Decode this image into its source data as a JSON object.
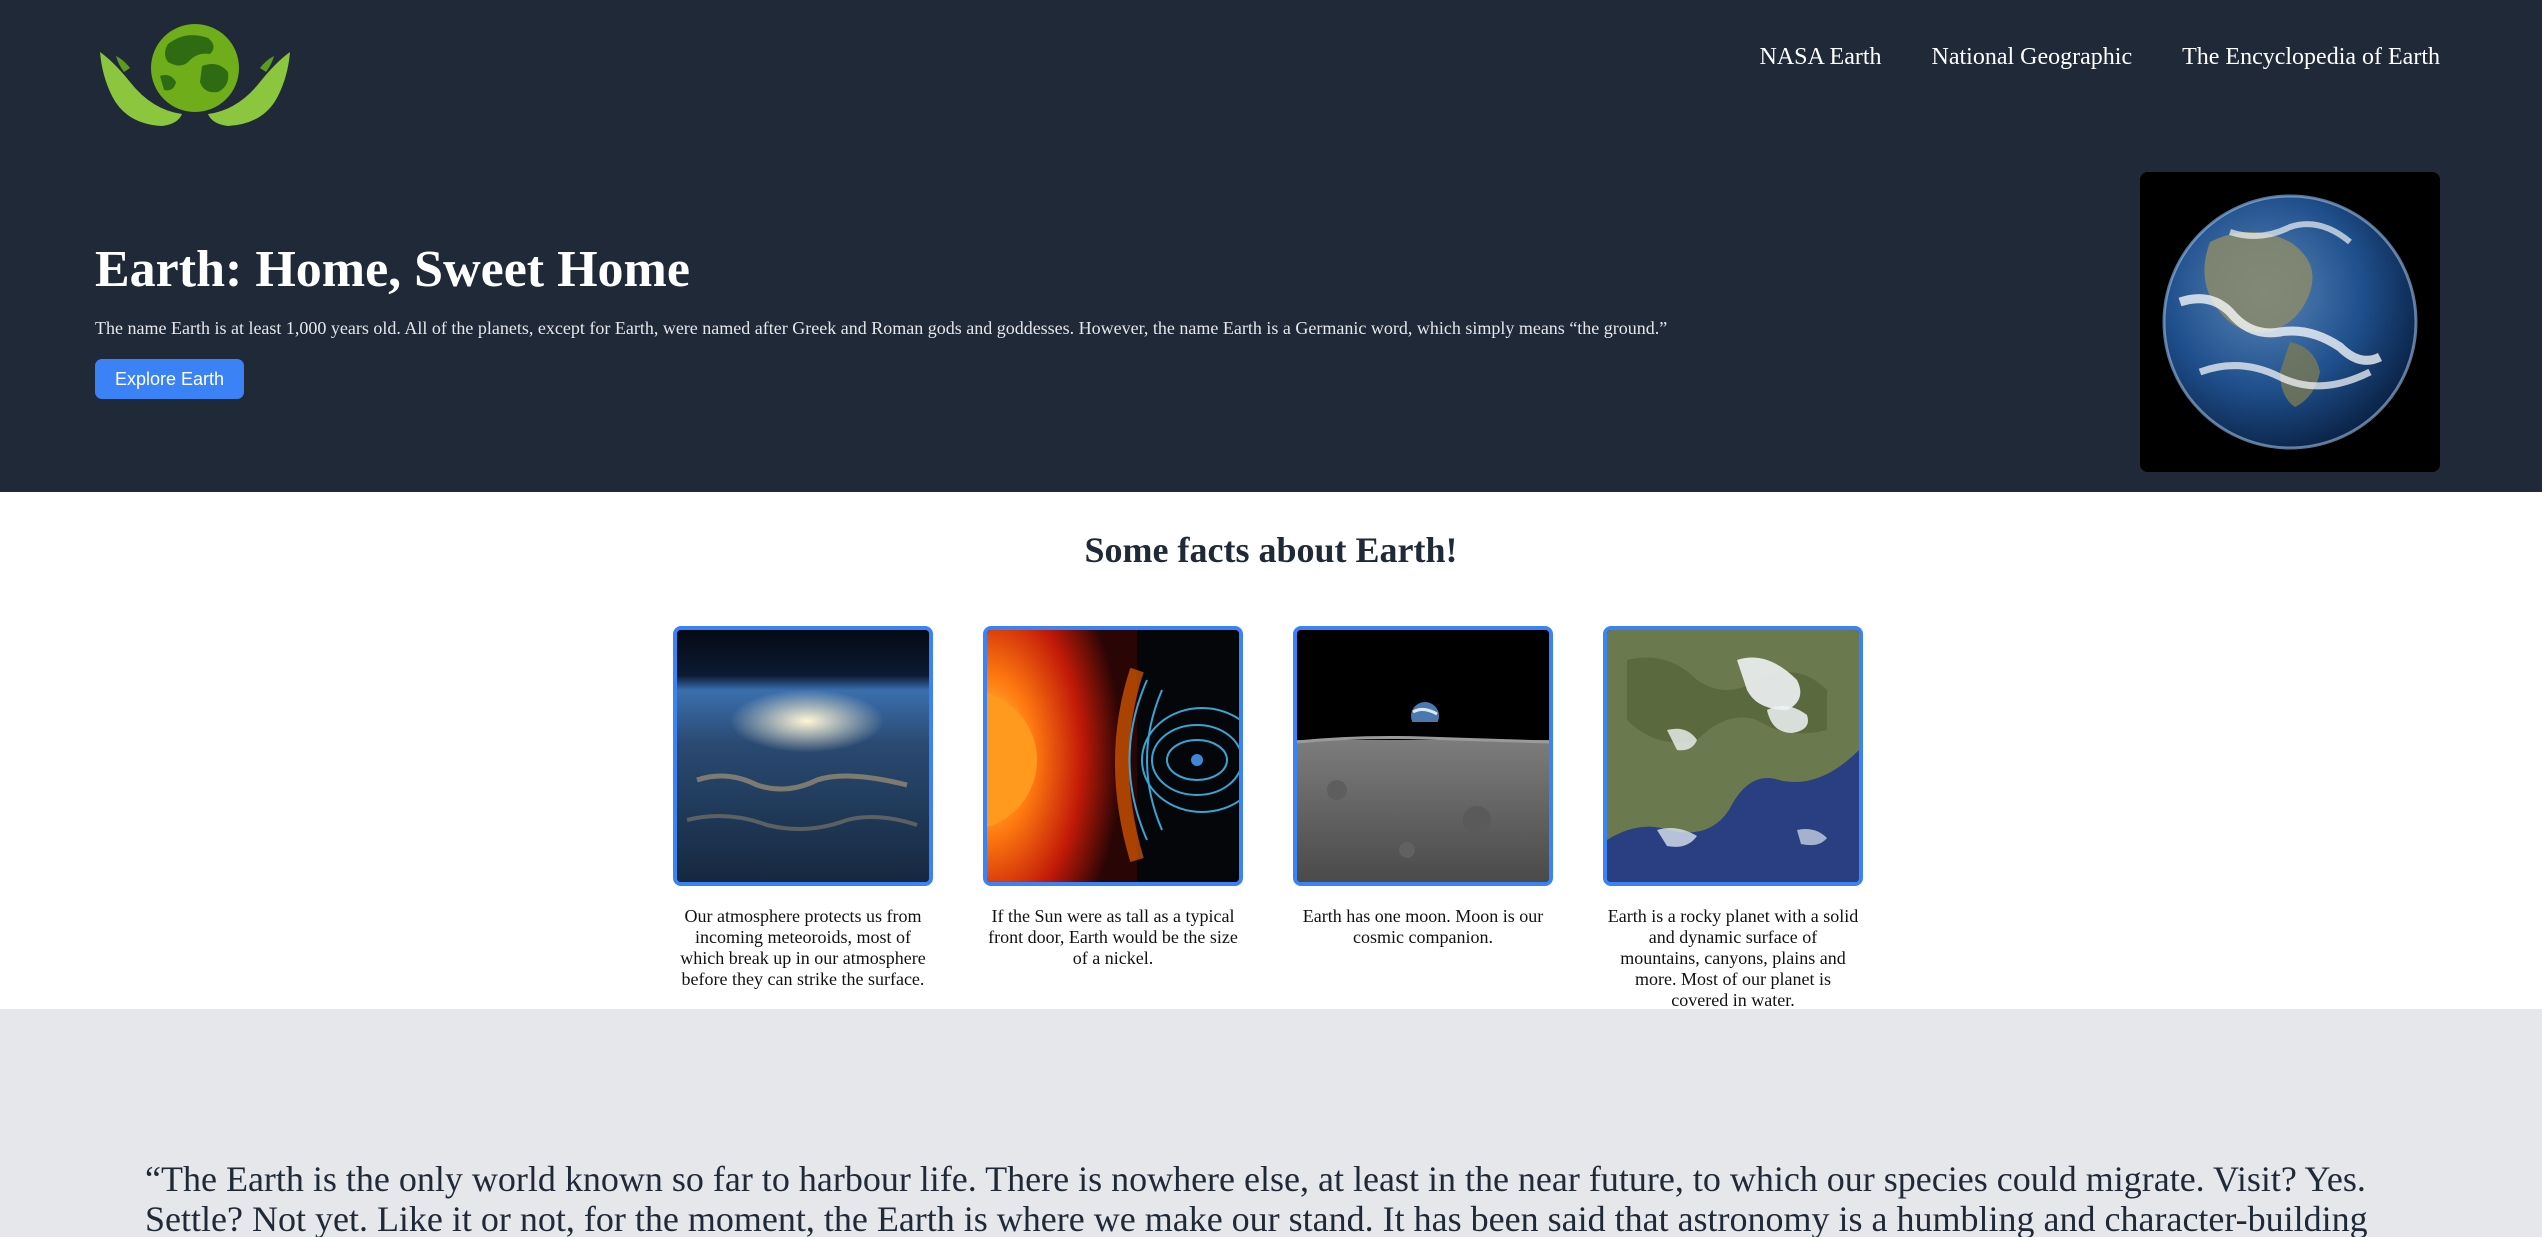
{
  "header": {
    "nav": [
      "NASA Earth",
      "National Geographic",
      "The Encyclopedia of Earth"
    ]
  },
  "hero": {
    "title": "Earth: Home, Sweet Home",
    "text": "The name Earth is at least 1,000 years old. All of the planets, except for Earth, were named after Greek and Roman gods and goddesses. However, the name Earth is a Germanic word, which simply means “the ground.”",
    "button_label": "Explore Earth"
  },
  "facts": {
    "title": "Some facts about Earth!",
    "items": [
      {
        "text": "Our atmosphere protects us from incoming meteoroids, most of which break up in our atmosphere before they can strike the surface.",
        "image": "earth-atmosphere-from-orbit"
      },
      {
        "text": "If the Sun were as tall as a typical front door, Earth would be the size of a nickel.",
        "image": "sun-and-earth-magnetosphere"
      },
      {
        "text": "Earth has one moon. Moon is our cosmic companion.",
        "image": "earthrise-over-moon"
      },
      {
        "text": "Earth is a rocky planet with a solid and dynamic surface of mountains, canyons, plains and more. Most of our planet is covered in water.",
        "image": "satellite-coastline"
      }
    ]
  },
  "quote": {
    "text": "“The Earth is the only world known so far to harbour life. There is nowhere else, at least in the near future, to which our species could migrate. Visit? Yes. Settle? Not yet. Like it or not, for the moment, the Earth is where we make our stand. It has been said that astronomy is a humbling and character-building"
  },
  "colors": {
    "header_bg": "#1f2937",
    "accent": "#3b82f6",
    "quote_bg": "#e5e7eb"
  }
}
